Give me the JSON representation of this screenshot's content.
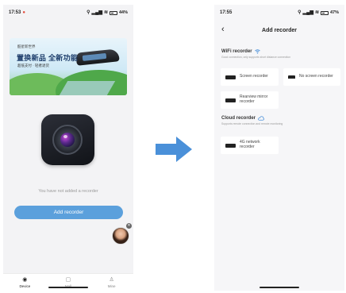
{
  "left_screen": {
    "status": {
      "time": "17:53",
      "battery": "44%"
    },
    "banner": {
      "brand": "酷星新世界",
      "title": "置换新品 全新功能",
      "subtitle": "超低支付 · 轻者退货"
    },
    "empty_message": "You have not added a recorder",
    "add_button_label": "Add recorder",
    "tabs": [
      {
        "label": "Device",
        "icon": "camera-icon"
      },
      {
        "label": "Mall",
        "icon": "bag-icon"
      },
      {
        "label": "Mine",
        "icon": "person-icon"
      }
    ]
  },
  "right_screen": {
    "status": {
      "time": "17:55",
      "battery": "47%"
    },
    "title": "Add recorder",
    "wifi_section": {
      "title": "WiFi recorder",
      "description": "Good connection, only supports short distance connection",
      "items": [
        {
          "label": "Screen recorder"
        },
        {
          "label": "No screen recorder"
        },
        {
          "label": "Rearview mirror recorder"
        }
      ]
    },
    "cloud_section": {
      "title": "Cloud recorder",
      "description": "Supports remote connection and remote monitoring",
      "items": [
        {
          "label": "4G network recorder"
        }
      ]
    }
  },
  "colors": {
    "accent": "#5ba0dc",
    "arrow": "#4a90d9"
  }
}
